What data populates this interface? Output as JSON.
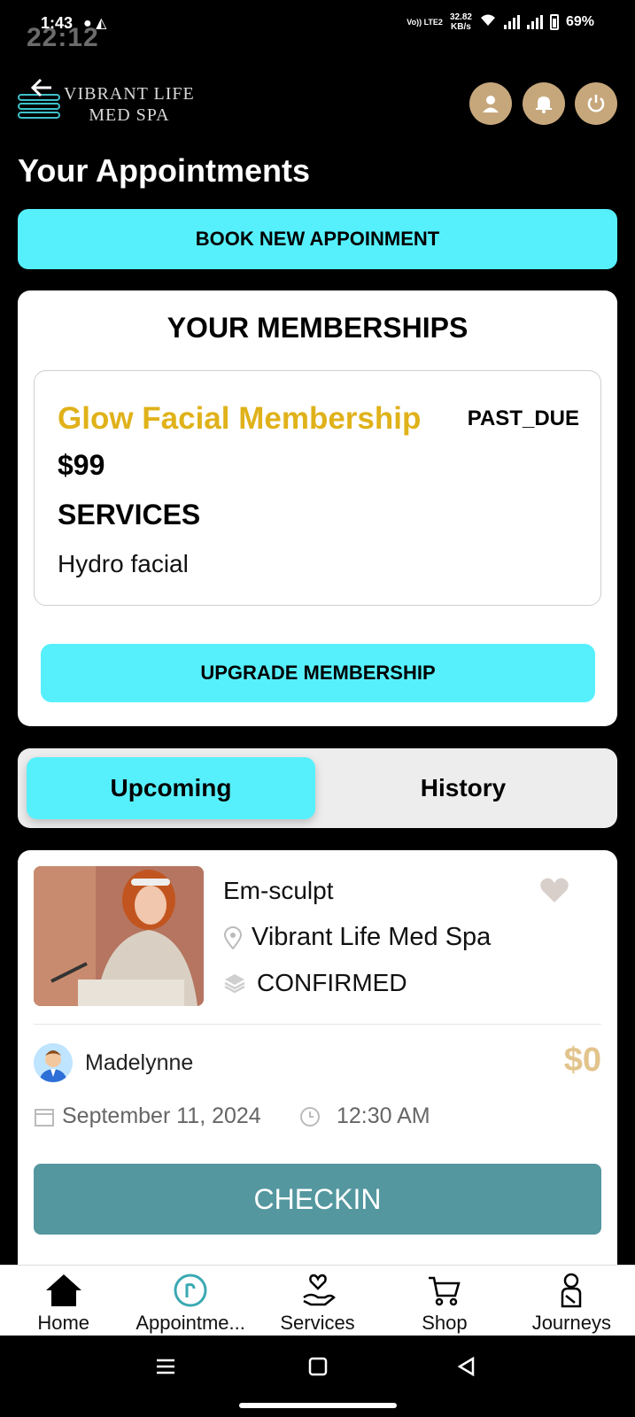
{
  "status_bar": {
    "time": "1:43",
    "ghost_time": "22:12",
    "network_speed": "32.82",
    "speed_unit": "KB/s",
    "network_type": "Vo)) LTE2",
    "battery": "69%"
  },
  "header": {
    "brand_line1": "VIBRANT LIFE",
    "brand_line2": "MED SPA",
    "brand_color": "#3ec1c9",
    "button_color": "#c6a77c"
  },
  "page_title": "Your Appointments",
  "book_button_label": "BOOK NEW APPOINMENT",
  "memberships": {
    "title": "YOUR MEMBERSHIPS",
    "name": "Glow Facial Membership",
    "status": "PAST_DUE",
    "price": "$99",
    "services_heading": "SERVICES",
    "services": "Hydro facial",
    "upgrade_label": "UPGRADE MEMBERSHIP",
    "accent_color": "#e0b21a"
  },
  "tabs": {
    "upcoming": "Upcoming",
    "history": "History",
    "active": "upcoming"
  },
  "appointment": {
    "service": "Em-sculpt",
    "location": "Vibrant Life Med Spa",
    "status": "CONFIRMED",
    "staff": "Madelynne",
    "price": "$0",
    "date": "September 11, 2024",
    "time": "12:30 AM",
    "checkin_label": "CHECKIN",
    "checkin_color": "#54979f"
  },
  "bottom_nav": {
    "home": "Home",
    "appointments": "Appointme...",
    "services": "Services",
    "shop": "Shop",
    "journeys": "Journeys",
    "active": "appointments",
    "active_color": "#3aa9b3"
  },
  "accent_cyan": "#56f0fd"
}
